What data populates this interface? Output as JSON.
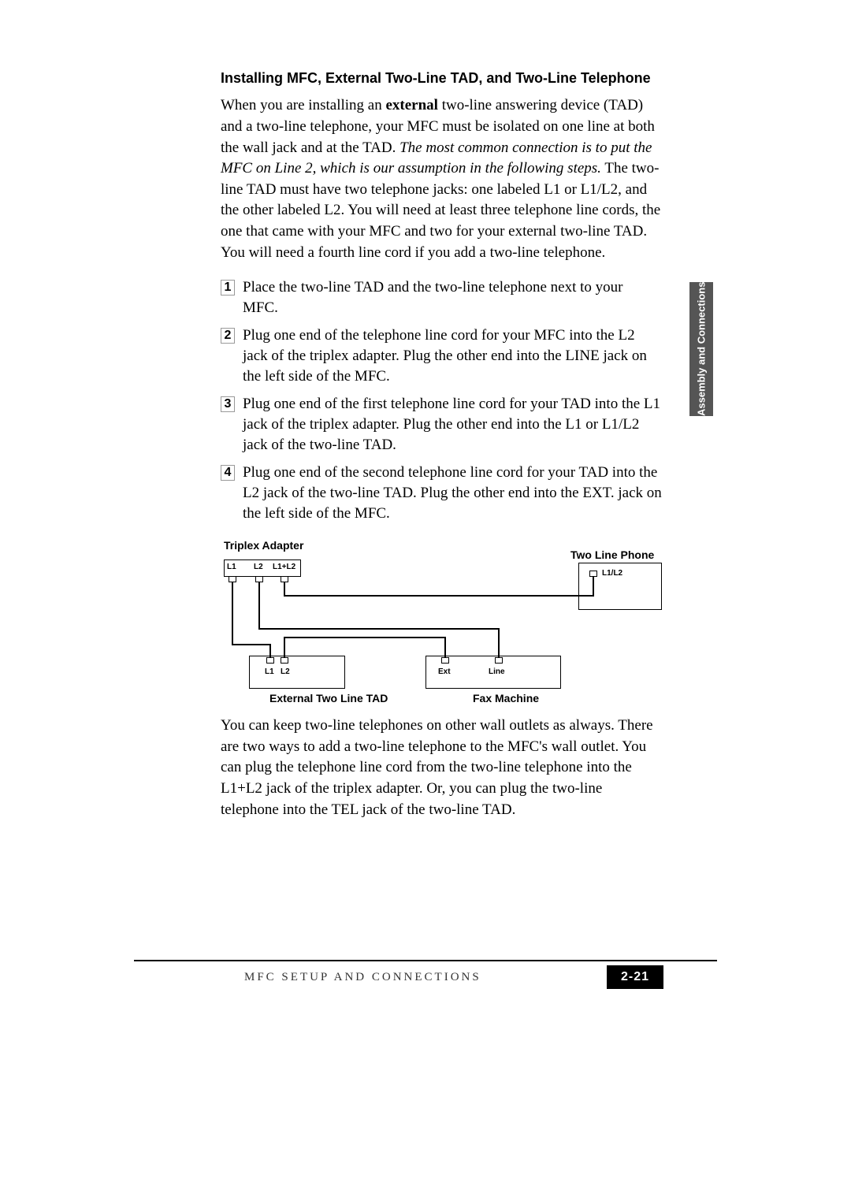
{
  "section_heading": "Installing MFC, External Two-Line TAD,  and Two-Line Telephone",
  "para1": {
    "start": "When you are installing an ",
    "bold1": "external",
    "mid1": " two-line answering device (TAD) and a two-line telephone, your MFC must be isolated on one line at both the wall jack and at the TAD. ",
    "italic1": "The most common connection is to put the MFC on Line 2, which is our assumption in the following steps.",
    "end": " The two-line TAD must have two telephone jacks: one labeled L1 or L1/L2, and the other labeled L2. You will need at least three telephone line cords, the one that came with your MFC and two for your external two-line TAD. You will need a fourth line cord if you add a two-line telephone."
  },
  "steps": [
    {
      "n": "1",
      "t": "Place the two-line TAD and the two-line telephone next to your MFC."
    },
    {
      "n": "2",
      "t": "Plug one end of the telephone line cord for your MFC into the L2 jack of the triplex adapter. Plug the other end into the LINE jack on the left side of the MFC."
    },
    {
      "n": "3",
      "t": "Plug one end of the first telephone line cord for your TAD into the L1 jack of the triplex adapter. Plug the other end into the L1 or L1/L2 jack of the two-line TAD."
    },
    {
      "n": "4",
      "t": "Plug one end of the second telephone line cord for your TAD into the L2 jack of the two-line TAD. Plug the other end into the EXT. jack on the left side of the MFC."
    }
  ],
  "diagram": {
    "triplex_label": "Triplex Adapter",
    "twoline_phone_label": "Two Line Phone",
    "external_tad_label": "External Two Line TAD",
    "fax_label": "Fax Machine",
    "jacks": {
      "triplex_l1": "L1",
      "triplex_l2": "L2",
      "triplex_l1l2": "L1+L2",
      "tad_l1": "L1",
      "tad_l2": "L2",
      "fax_ext": "Ext",
      "fax_line": "Line",
      "phone_l1l2": "L1/L2"
    }
  },
  "para2": "You can keep two-line telephones on other wall outlets as always. There are two ways to add a two-line telephone to the MFC's wall outlet. You can plug the telephone line cord from the two-line telephone into the L1+L2 jack of the triplex adapter.  Or, you can plug the two-line telephone into the TEL jack of the two-line TAD.",
  "footer_text": "MFC SETUP AND CONNECTIONS",
  "page_number": "2-21",
  "side_tab": "Assembly and\nConnections"
}
